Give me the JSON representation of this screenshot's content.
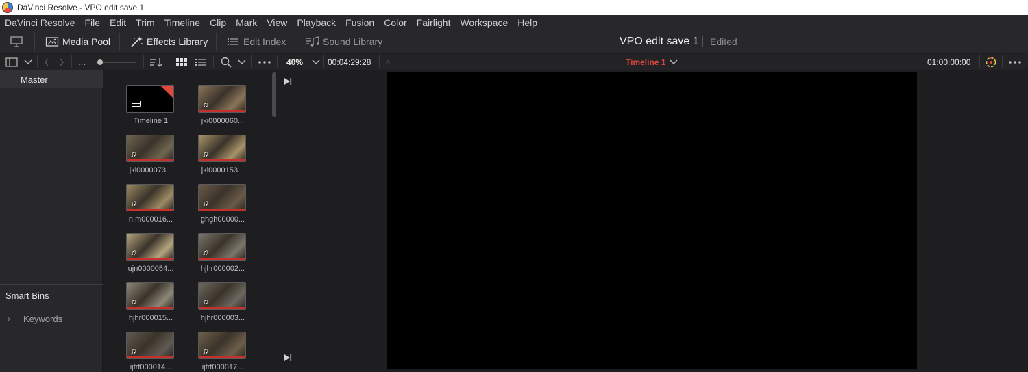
{
  "window": {
    "title": "DaVinci Resolve - VPO edit save 1"
  },
  "menu": [
    "DaVinci Resolve",
    "File",
    "Edit",
    "Trim",
    "Timeline",
    "Clip",
    "Mark",
    "View",
    "Playback",
    "Fusion",
    "Color",
    "Fairlight",
    "Workspace",
    "Help"
  ],
  "toolbar": {
    "media_pool": "Media Pool",
    "effects_library": "Effects Library",
    "edit_index": "Edit Index",
    "sound_library": "Sound Library"
  },
  "project": {
    "name": "VPO edit save 1",
    "status": "Edited"
  },
  "subbar": {
    "ellipsis": "...",
    "zoom": "40%",
    "source_timecode": "00:04:29:28",
    "timeline_name": "Timeline 1",
    "record_timecode": "01:00:00:00"
  },
  "bins": {
    "master": "Master",
    "smart_bins": "Smart Bins",
    "keywords": "Keywords"
  },
  "clips": [
    {
      "label": "Timeline 1",
      "kind": "timeline"
    },
    {
      "label": "jki0000060...",
      "kind": "clip",
      "tone": "#8a7458"
    },
    {
      "label": "jki0000073...",
      "kind": "clip",
      "tone": "#6f6550"
    },
    {
      "label": "jki0000153...",
      "kind": "clip",
      "tone": "#a89268"
    },
    {
      "label": "n.m000016...",
      "kind": "clip",
      "tone": "#9c8a62"
    },
    {
      "label": "ghgh00000...",
      "kind": "clip",
      "tone": "#6a5a48"
    },
    {
      "label": "ujn0000054...",
      "kind": "clip",
      "tone": "#b5a47e"
    },
    {
      "label": "hjhr000002...",
      "kind": "clip",
      "tone": "#7a766c"
    },
    {
      "label": "hjhr000015...",
      "kind": "clip",
      "tone": "#8d8778"
    },
    {
      "label": "hjhr000003...",
      "kind": "clip",
      "tone": "#6c6860"
    },
    {
      "label": "ijfrt000014...",
      "kind": "clip",
      "tone": "#5f5a52"
    },
    {
      "label": "ijfrt000017...",
      "kind": "clip",
      "tone": "#6d5f4a"
    }
  ],
  "colors": {
    "accent_red": "#e0483e",
    "timeline_name": "#d9453c"
  }
}
